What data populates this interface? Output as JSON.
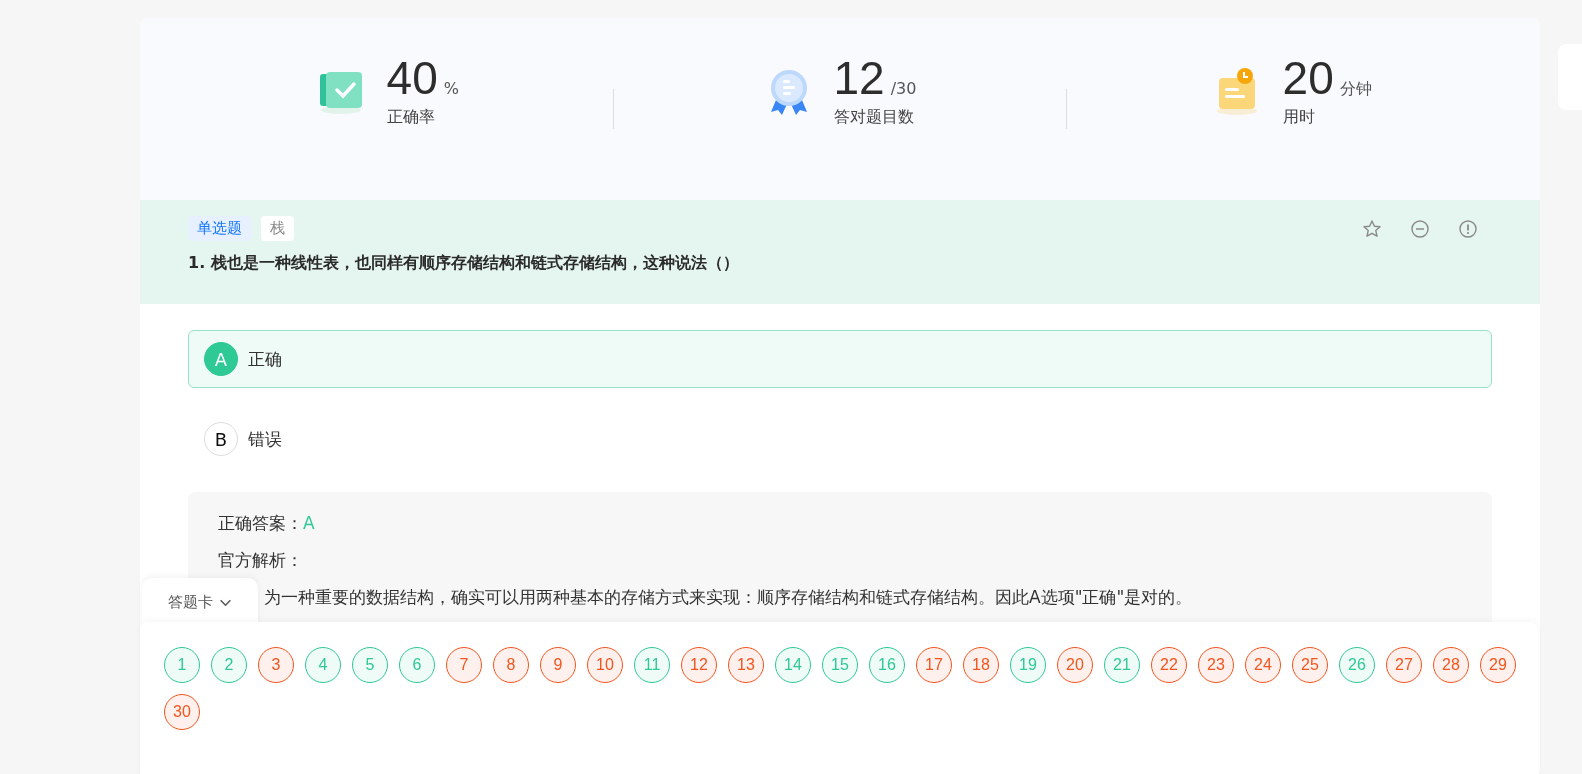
{
  "stats": [
    {
      "kind": "accuracy",
      "value": "40",
      "unit": "%",
      "label": "正确率"
    },
    {
      "kind": "correct",
      "value": "12",
      "unit": "/30",
      "label": "答对题目数"
    },
    {
      "kind": "time",
      "value": "20",
      "unit": "分钟",
      "label": "用时"
    }
  ],
  "question": {
    "type_tag": "单选题",
    "topic_tag": "栈",
    "text": "1. 栈也是一种线性表，也同样有顺序存储结构和链式存储结构，这种说法（）",
    "options": [
      {
        "letter": "A",
        "text": "正确",
        "selected": true
      },
      {
        "letter": "B",
        "text": "错误",
        "selected": false
      }
    ]
  },
  "analysis": {
    "answer_label": "正确答案：",
    "answer": "A",
    "explanation_label": "官方解析：",
    "explanation": "为一种重要的数据结构，确实可以用两种基本的存储方式来实现：顺序存储结构和链式存储结构。因此A选项\"正确\"是对的。"
  },
  "answer_card": {
    "title": "答题卡",
    "items": [
      {
        "number": "1",
        "color": "#2ec995"
      },
      {
        "number": "2",
        "color": "#2ec995"
      },
      {
        "number": "3",
        "color": "#f2551e"
      },
      {
        "number": "4",
        "color": "#2ec995"
      },
      {
        "number": "5",
        "color": "#2ec995"
      },
      {
        "number": "6",
        "color": "#2ec995"
      },
      {
        "number": "7",
        "color": "#f2551e"
      },
      {
        "number": "8",
        "color": "#f2551e"
      },
      {
        "number": "9",
        "color": "#f2551e"
      },
      {
        "number": "10",
        "color": "#f2551e"
      },
      {
        "number": "11",
        "color": "#2ec995"
      },
      {
        "number": "12",
        "color": "#f2551e"
      },
      {
        "number": "13",
        "color": "#f2551e"
      },
      {
        "number": "14",
        "color": "#2ec995"
      },
      {
        "number": "15",
        "color": "#2ec995"
      },
      {
        "number": "16",
        "color": "#2ec995"
      },
      {
        "number": "17",
        "color": "#f2551e"
      },
      {
        "number": "18",
        "color": "#f2551e"
      },
      {
        "number": "19",
        "color": "#2ec995"
      },
      {
        "number": "20",
        "color": "#f2551e"
      },
      {
        "number": "21",
        "color": "#2ec995"
      },
      {
        "number": "22",
        "color": "#f2551e"
      },
      {
        "number": "23",
        "color": "#f2551e"
      },
      {
        "number": "24",
        "color": "#f2551e"
      },
      {
        "number": "25",
        "color": "#f2551e"
      },
      {
        "number": "26",
        "color": "#2ec995"
      },
      {
        "number": "27",
        "color": "#f2551e"
      },
      {
        "number": "28",
        "color": "#f2551e"
      },
      {
        "number": "29",
        "color": "#f2551e"
      },
      {
        "number": "30",
        "color": "#f2551e"
      }
    ]
  }
}
